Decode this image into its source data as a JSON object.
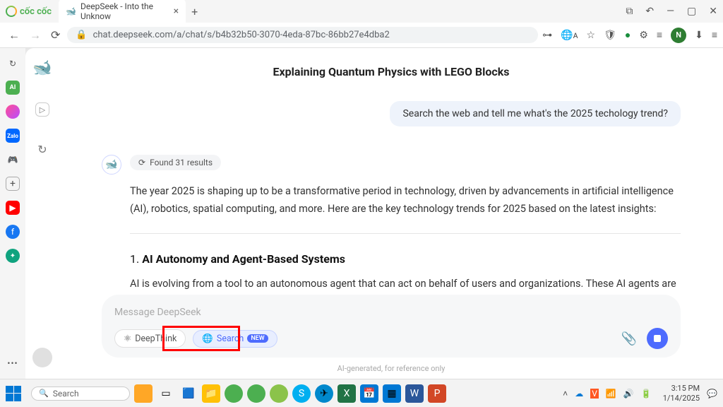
{
  "browser": {
    "brand": "cốc cốc",
    "tab_title": "DeepSeek - Into the Unknow",
    "url": "chat.deepseek.com/a/chat/s/b4b32b50-3070-4eda-87bc-86bb27e4dba2",
    "avatar_letter": "N"
  },
  "chat": {
    "title": "Explaining Quantum Physics with LEGO Blocks",
    "user_message": "Search the web and tell me what's the 2025 techology trend?",
    "results_pill": "Found 31 results",
    "intro": "The year 2025 is shaping up to be a transformative period in technology, driven by advancements in artificial intelligence (AI), robotics, spatial computing, and more. Here are the key technology trends for 2025 based on the latest insights:",
    "heading1": "AI Autonomy and Agent-Based Systems",
    "para1": "AI is evolving from a tool to an autonomous agent that can act on behalf of users and organizations. These AI agents are becoming integral to enterprise systems, enabling natural"
  },
  "composer": {
    "placeholder": "Message DeepSeek",
    "deepthink": "DeepThink",
    "search": "Search",
    "new_badge": "NEW"
  },
  "footnote": "AI-generated, for reference only",
  "taskbar": {
    "search_placeholder": "Search",
    "time": "3:15 PM",
    "date": "1/14/2025"
  }
}
